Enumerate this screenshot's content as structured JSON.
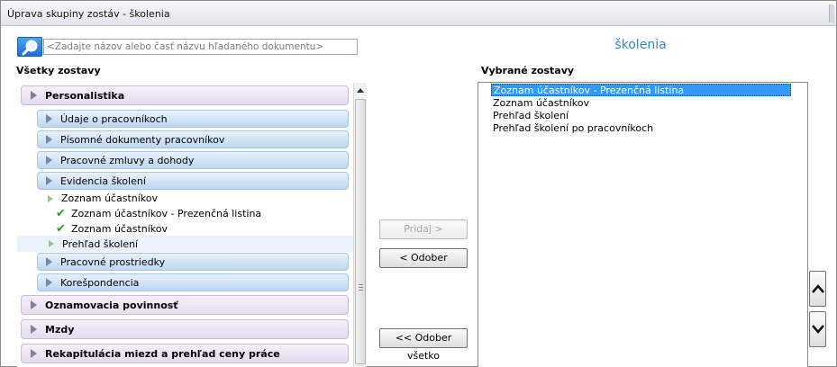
{
  "window": {
    "title": "Úprava skupiny zostáv - školenia"
  },
  "search": {
    "placeholder": "<Zadajte názov alebo časť názvu hľadaného dokumentu>"
  },
  "group_title": "školenia",
  "left_panel": {
    "label": "Všetky zostavy",
    "tree": [
      {
        "kind": "cat",
        "label": "Personalistika"
      },
      {
        "kind": "sub",
        "label": "Údaje o pracovníkoch"
      },
      {
        "kind": "sub",
        "label": "Písomné dokumenty pracovníkov"
      },
      {
        "kind": "sub",
        "label": "Pracovné zmluvy a dohody"
      },
      {
        "kind": "sub",
        "label": "Evidencia školení"
      },
      {
        "kind": "leaf",
        "label": "Zoznam účastníkov"
      },
      {
        "kind": "leaf-check",
        "label": "Zoznam účastníkov - Prezenčná listina"
      },
      {
        "kind": "leaf-check",
        "label": "Zoznam účastníkov"
      },
      {
        "kind": "leaf-hl",
        "label": "Prehľad školení"
      },
      {
        "kind": "sub",
        "label": "Pracovné prostriedky"
      },
      {
        "kind": "sub",
        "label": "Korešpondencia"
      },
      {
        "kind": "cat",
        "label": "Oznamovacia povinnosť"
      },
      {
        "kind": "cat",
        "label": "Mzdy"
      },
      {
        "kind": "cat",
        "label": "Rekapitulácia miezd a prehľad ceny práce"
      }
    ]
  },
  "buttons": {
    "add": "Pridaj >",
    "remove": "< Odober",
    "remove_all": "<< Odober všetko"
  },
  "right_panel": {
    "label": "Vybrané zostavy",
    "items": [
      {
        "label": "Zoznam účastníkov - Prezenčná listina",
        "selected": true
      },
      {
        "label": "Zoznam účastníkov",
        "selected": false
      },
      {
        "label": "Prehľad školení",
        "selected": false
      },
      {
        "label": "Prehľad školení po pracovníkoch",
        "selected": false
      }
    ]
  },
  "icons": {
    "search": "magnifier-icon",
    "move_up": "chevron-up-icon",
    "move_down": "chevron-down-icon",
    "check": "checkmark-icon"
  },
  "colors": {
    "accent": "#2e84d0",
    "selection": "#3399ff",
    "check": "#2e9a27"
  }
}
